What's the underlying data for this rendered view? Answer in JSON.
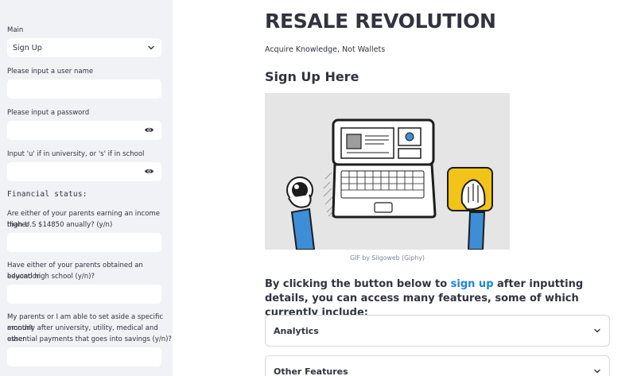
{
  "sidebar": {
    "main_label": "Main",
    "main_select_value": "Sign Up",
    "username_label": "Please input a user name",
    "password_label": "Please input a password",
    "school_label": "Input 'u' if in university, or 's' if in school",
    "financial_heading": "Financial status:",
    "income_label_line1": "Are either of your parents earning an income higher",
    "income_label_line2": "than U.S $14850 anually? (y/n)",
    "education_label_line1": "Have either of your parents obtained an education",
    "education_label_line2": "beyond high school (y/n)?",
    "savings_label_line1": "My parents or I am able to set aside a specific amount",
    "savings_label_line2": "monthly after university, utility, medical and other",
    "savings_label_line3": "essential payments that goes into savings (y/n)?"
  },
  "main": {
    "title": "RESALE REVOLUTION",
    "subtitle": "Acquire Knowledge, Not Wallets",
    "heading": "Sign Up Here",
    "gif_caption": "GIF by Silgoweb (Giphy)",
    "para_before": "By clicking the button below to ",
    "para_link": "sign up",
    "para_after": " after inputting details, you can access many features, some of which currently include:",
    "expanders": [
      {
        "label": "Analytics"
      },
      {
        "label": "Other Features"
      }
    ]
  },
  "colors": {
    "sidebar_bg": "#f0f2f6",
    "link": "#1c83e1",
    "text": "#31333f",
    "tablet_yellow": "#f2c318",
    "arm_blue": "#3d8ed6"
  }
}
